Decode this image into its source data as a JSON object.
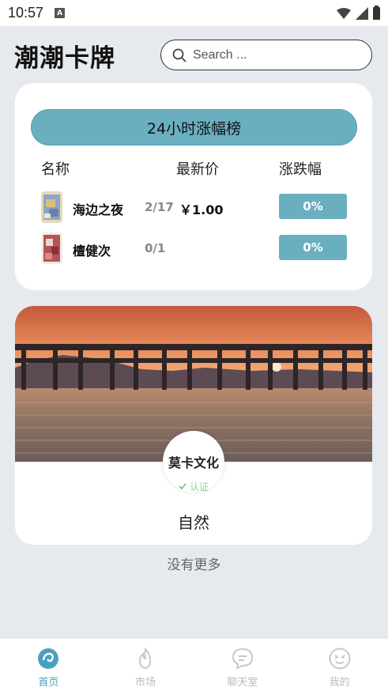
{
  "status_bar": {
    "time": "10:57",
    "notification_badge": "A"
  },
  "header": {
    "logo": "潮潮卡牌",
    "search_placeholder": "Search ..."
  },
  "ranking": {
    "title": "24小时涨幅榜",
    "columns": {
      "name": "名称",
      "price": "最新价",
      "change": "涨跌幅"
    },
    "rows": [
      {
        "name": "海边之夜",
        "count": "2/17",
        "price": "￥1.00",
        "change": "0%"
      },
      {
        "name": "檀健次",
        "count": "0/1",
        "price": "",
        "change": "0%"
      }
    ]
  },
  "feature": {
    "publisher": "莫卡文化",
    "verified_label": "认证",
    "title": "自然"
  },
  "footer_text": "没有更多",
  "nav": {
    "items": [
      {
        "label": "首页",
        "icon": "home-icon",
        "active": true
      },
      {
        "label": "市场",
        "icon": "flame-icon",
        "active": false
      },
      {
        "label": "聊天室",
        "icon": "chat-icon",
        "active": false
      },
      {
        "label": "我的",
        "icon": "smiley-icon",
        "active": false
      }
    ]
  },
  "colors": {
    "accent": "#6aafc0",
    "nav_active": "#4aa0bf",
    "background": "#e6eaee"
  }
}
